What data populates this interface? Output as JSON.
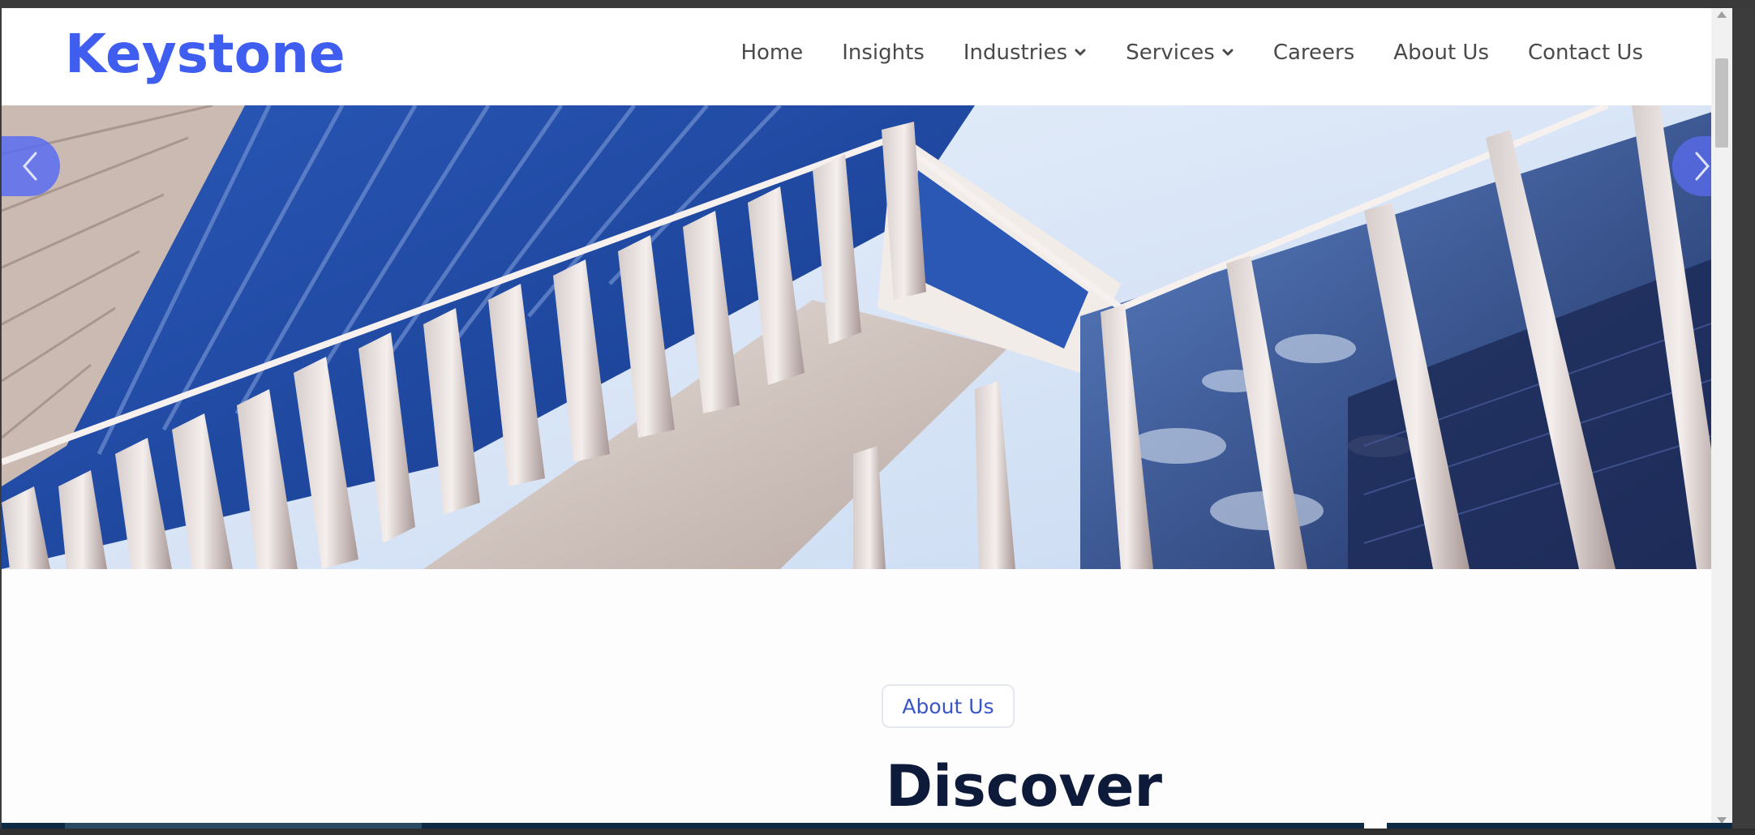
{
  "brand": {
    "name": "Keystone",
    "color": "#3f5ef0"
  },
  "nav": {
    "items": [
      {
        "label": "Home",
        "has_dropdown": false
      },
      {
        "label": "Insights",
        "has_dropdown": false
      },
      {
        "label": "Industries",
        "has_dropdown": true
      },
      {
        "label": "Services",
        "has_dropdown": true
      },
      {
        "label": "Careers",
        "has_dropdown": false
      },
      {
        "label": "About Us",
        "has_dropdown": false
      },
      {
        "label": "Contact Us",
        "has_dropdown": false
      }
    ],
    "text_color": "#4a4a4a"
  },
  "hero": {
    "prev_icon": "chevron-left-icon",
    "next_icon": "chevron-right-icon",
    "button_color": "#5b6cf0"
  },
  "about": {
    "badge_label": "About Us",
    "badge_color": "#3a55c8",
    "heading": "Discover",
    "heading_color": "#0e1a3a"
  }
}
